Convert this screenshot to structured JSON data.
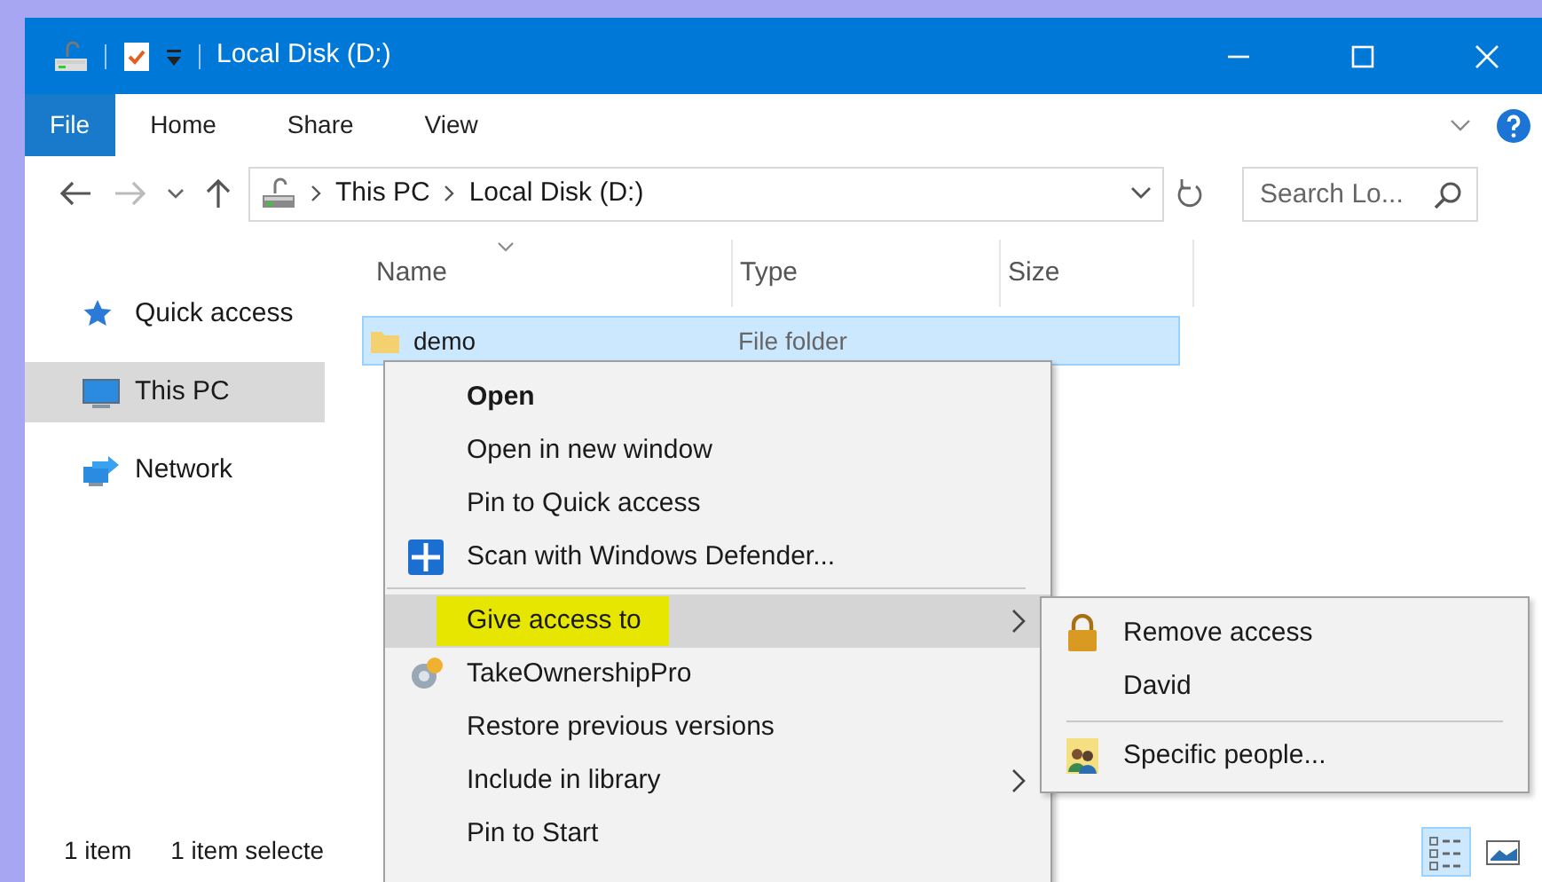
{
  "window": {
    "title": "Local Disk (D:)"
  },
  "ribbon_tabs": [
    {
      "label": "File",
      "selected": true
    },
    {
      "label": "Home",
      "selected": false
    },
    {
      "label": "Share",
      "selected": false
    },
    {
      "label": "View",
      "selected": false
    }
  ],
  "address_bar": {
    "path": [
      "This PC",
      "Local Disk (D:)"
    ]
  },
  "search": {
    "placeholder": "Search Lo..."
  },
  "sidebar": {
    "items": [
      {
        "label": "Quick access",
        "selected": false
      },
      {
        "label": "This PC",
        "selected": true
      },
      {
        "label": "Network",
        "selected": false
      }
    ]
  },
  "file_list": {
    "columns": [
      "Name",
      "Type",
      "Size"
    ],
    "rows": [
      {
        "name": "demo",
        "type": "File folder",
        "selected": true
      }
    ]
  },
  "context_menu": {
    "items": [
      {
        "kind": "item",
        "label": "Open",
        "bold": true,
        "icon": false,
        "submenu": false,
        "selected": false,
        "highlighted": false
      },
      {
        "kind": "item",
        "label": "Open in new window",
        "bold": false,
        "icon": false,
        "submenu": false,
        "selected": false,
        "highlighted": false
      },
      {
        "kind": "item",
        "label": "Pin to Quick access",
        "bold": false,
        "icon": false,
        "submenu": false,
        "selected": false,
        "highlighted": false
      },
      {
        "kind": "item",
        "label": "Scan with Windows Defender...",
        "bold": false,
        "icon": true,
        "submenu": false,
        "selected": false,
        "highlighted": false
      },
      {
        "kind": "separator"
      },
      {
        "kind": "item",
        "label": "Give access to",
        "bold": false,
        "icon": false,
        "submenu": true,
        "selected": true,
        "highlighted": true
      },
      {
        "kind": "item",
        "label": "TakeOwnershipPro",
        "bold": false,
        "icon": true,
        "submenu": false,
        "selected": false,
        "highlighted": false
      },
      {
        "kind": "item",
        "label": "Restore previous versions",
        "bold": false,
        "icon": false,
        "submenu": false,
        "selected": false,
        "highlighted": false
      },
      {
        "kind": "item",
        "label": "Include in library",
        "bold": false,
        "icon": false,
        "submenu": true,
        "selected": false,
        "highlighted": false
      },
      {
        "kind": "item",
        "label": "Pin to Start",
        "bold": false,
        "icon": false,
        "submenu": false,
        "selected": false,
        "highlighted": false
      }
    ]
  },
  "submenu": {
    "items": [
      {
        "kind": "item",
        "label": "Remove access",
        "icon": true
      },
      {
        "kind": "item",
        "label": "David",
        "icon": false
      },
      {
        "kind": "separator"
      },
      {
        "kind": "item",
        "label": "Specific people...",
        "icon": true
      }
    ]
  },
  "status_bar": {
    "count": "1 item",
    "selection": "1 item selecte"
  },
  "view_buttons": [
    {
      "kind": "details",
      "selected": true
    },
    {
      "kind": "large-icons",
      "selected": false
    }
  ]
}
